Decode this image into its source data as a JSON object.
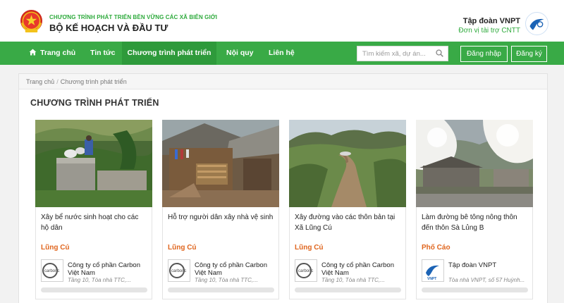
{
  "header": {
    "org_sub": "CHƯƠNG TRÌNH PHÁT TRIỂN BỀN VỮNG CÁC XÃ BIÊN GIỚI",
    "org_name": "BỘ KẾ HOẠCH VÀ ĐẦU TƯ",
    "sponsor_name": "Tập đoàn VNPT",
    "sponsor_sub": "Đơn vị tài trợ CNTT"
  },
  "nav": {
    "items": [
      "Trang chủ",
      "Tin tức",
      "Chương trình phát triển",
      "Nội quy",
      "Liên hệ"
    ],
    "active_index": 2,
    "search_placeholder": "Tìm kiếm xã, dự án...",
    "login_label": "Đăng nhập",
    "register_label": "Đăng ký"
  },
  "breadcrumb": [
    "Trang chủ",
    "Chương trình phát triển"
  ],
  "page_title": "CHƯƠNG TRÌNH PHÁT TRIỂN",
  "cards": [
    {
      "title": "Xây bể nước sinh hoạt cho các hộ dân",
      "location": "Lũng Cú",
      "company": "Công ty cổ phần Carbon Việt Nam",
      "address": "Tầng 10, Tòa nhà TTC,...",
      "logo": "carboncor-logo"
    },
    {
      "title": "Hỗ trợ người dân xây nhà vệ sinh",
      "location": "Lũng Cú",
      "company": "Công ty cổ phần Carbon Việt Nam",
      "address": "Tầng 10, Tòa nhà TTC,...",
      "logo": "carboncor-logo"
    },
    {
      "title": "Xây đường vào các thôn bản tại Xã Lũng Cú",
      "location": "Lũng Cú",
      "company": "Công ty cổ phần Carbon Việt Nam",
      "address": "Tầng 10, Tòa nhà TTC,...",
      "logo": "carboncor-logo"
    },
    {
      "title": "Làm đường bê tông nông thôn đến thôn Sà Lủng B",
      "location": "Phố Cáo",
      "company": "Tập đoàn VNPT",
      "address": "Tòa nhà VNPT, số 57 Huỳnh...",
      "logo": "vnpt-logo"
    }
  ],
  "colors": {
    "brand_green": "#39aa46",
    "accent_orange": "#e0661f",
    "vnpt_blue": "#1b63b5"
  },
  "logo_text": {
    "carboncor": "carbonc",
    "vnpt": "VNPT"
  }
}
